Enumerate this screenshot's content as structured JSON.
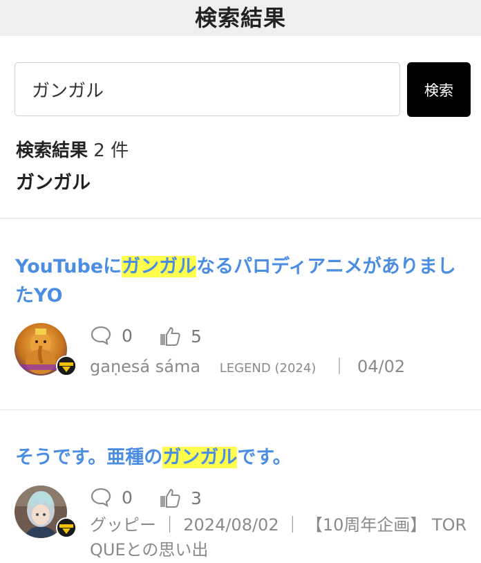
{
  "header": {
    "title": "検索結果"
  },
  "search": {
    "value": "ガンガル",
    "button_label": "検索"
  },
  "summary": {
    "label": "検索結果",
    "count": "2 件",
    "query": "ガンガル"
  },
  "posts": [
    {
      "title_before": "YouTubeに",
      "title_highlight": "ガンガル",
      "title_after": "なるパロディアニメがありましたYO",
      "comments": "0",
      "likes": "5",
      "author": "gaṇesá sáma",
      "rank": "LEGEND (2024)",
      "separator": "｜",
      "date": "04/02"
    },
    {
      "title_before": "そうです。亜種の",
      "title_highlight": "ガンガル",
      "title_after": "です。",
      "comments": "0",
      "likes": "3",
      "meta_line": "グッピー ｜ 2024/08/02 ｜ 【10周年企画】 TORQUEとの思い出"
    }
  ],
  "colors": {
    "title_link": "#4a8de3",
    "highlight": "#ffff4d",
    "button_bg": "#000000",
    "meta_text": "#8a8a8a"
  }
}
